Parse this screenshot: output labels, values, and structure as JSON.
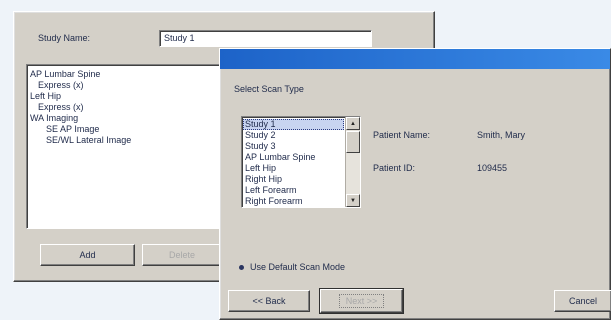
{
  "back_dialog": {
    "study_name_label": "Study Name:",
    "study_name_value": "Study 1",
    "tree_items": [
      {
        "text": "AP Lumbar Spine",
        "indent": 0
      },
      {
        "text": "Express (x)",
        "indent": 1
      },
      {
        "text": "Left Hip",
        "indent": 0
      },
      {
        "text": "Express (x)",
        "indent": 1
      },
      {
        "text": "WA Imaging",
        "indent": 0
      },
      {
        "text": "SE AP Image",
        "indent": 2
      },
      {
        "text": "SE/WL Lateral Image",
        "indent": 2
      }
    ],
    "add_button": "Add",
    "delete_button": "Delete"
  },
  "front_dialog": {
    "heading": "Select Scan Type",
    "scan_types": [
      "Study 1",
      "Study 2",
      "Study 3",
      "AP Lumbar Spine",
      "Left Hip",
      "Right Hip",
      "Left Forearm",
      "Right Forearm"
    ],
    "selected_index": 0,
    "patient_name_label": "Patient Name:",
    "patient_name_value": "Smith, Mary",
    "patient_id_label": "Patient ID:",
    "patient_id_value": "109455",
    "use_default_label": "Use Default Scan Mode",
    "back_button": "<< Back",
    "next_button": "Next >>",
    "cancel_button": "Cancel"
  },
  "colors": {
    "titlebar": "#1d63c8",
    "dialog_face": "#d4d0c8",
    "background": "#eef3f9",
    "text": "#1f2a4a"
  }
}
